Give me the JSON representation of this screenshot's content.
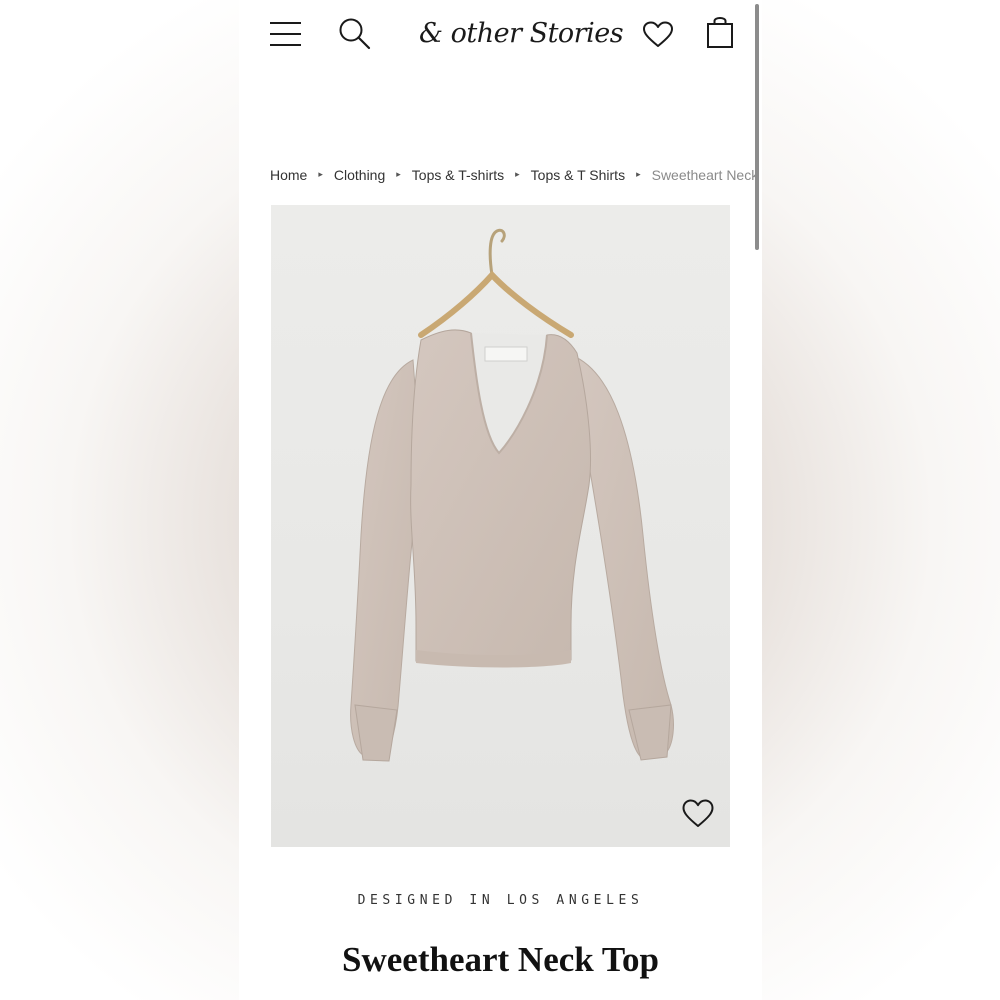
{
  "header": {
    "logo_text": "& other Stories",
    "icons": [
      "menu-icon",
      "search-icon",
      "heart-icon",
      "shopping-bag-icon"
    ]
  },
  "breadcrumb": {
    "items": [
      "Home",
      "Clothing",
      "Tops & T-shirts",
      "Tops & T Shirts",
      "Sweetheart Neck T"
    ]
  },
  "product": {
    "tagline": "DESIGNED IN LOS ANGELES",
    "title": "Sweetheart Neck Top",
    "image_colors": {
      "background": "#e9e9e7",
      "garment": "#cdbfb6"
    }
  }
}
